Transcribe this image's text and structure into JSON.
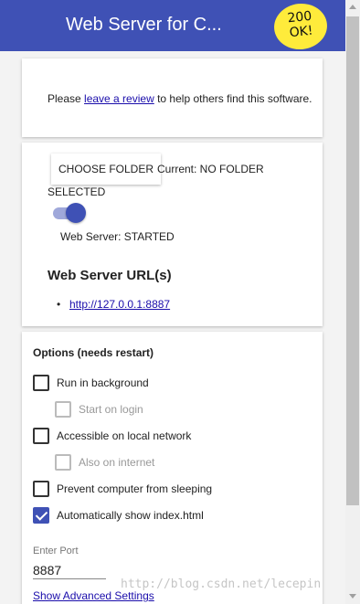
{
  "header": {
    "title": "Web Server for C...",
    "badge": "200 OK!"
  },
  "review": {
    "prefix": "Please ",
    "link": "leave a review",
    "suffix": " to help others find this software."
  },
  "folder": {
    "button": "CHOOSE FOLDER",
    "current": "Current: NO FOLDER",
    "current_cont": "SELECTED"
  },
  "server": {
    "enabled": true,
    "status": "Web Server: STARTED",
    "url_heading": "Web Server URL(s)",
    "urls": [
      "http://127.0.0.1:8887"
    ]
  },
  "options": {
    "heading": "Options (needs restart)",
    "items": [
      {
        "label": "Run in background",
        "checked": false,
        "disabled": false
      },
      {
        "label": "Start on login",
        "checked": false,
        "disabled": true
      },
      {
        "label": "Accessible on local network",
        "checked": false,
        "disabled": false
      },
      {
        "label": "Also on internet",
        "checked": false,
        "disabled": true
      },
      {
        "label": "Prevent computer from sleeping",
        "checked": false,
        "disabled": false
      },
      {
        "label": "Automatically show index.html",
        "checked": true,
        "disabled": false
      }
    ],
    "port_label": "Enter Port",
    "port_value": "8887",
    "advanced_link": "Show Advanced Settings"
  },
  "watermark": "http://blog.csdn.net/lecepin",
  "colors": {
    "primary": "#3f51b5",
    "toggle_track": "#9fa8da",
    "badge": "#ffeb3b"
  }
}
